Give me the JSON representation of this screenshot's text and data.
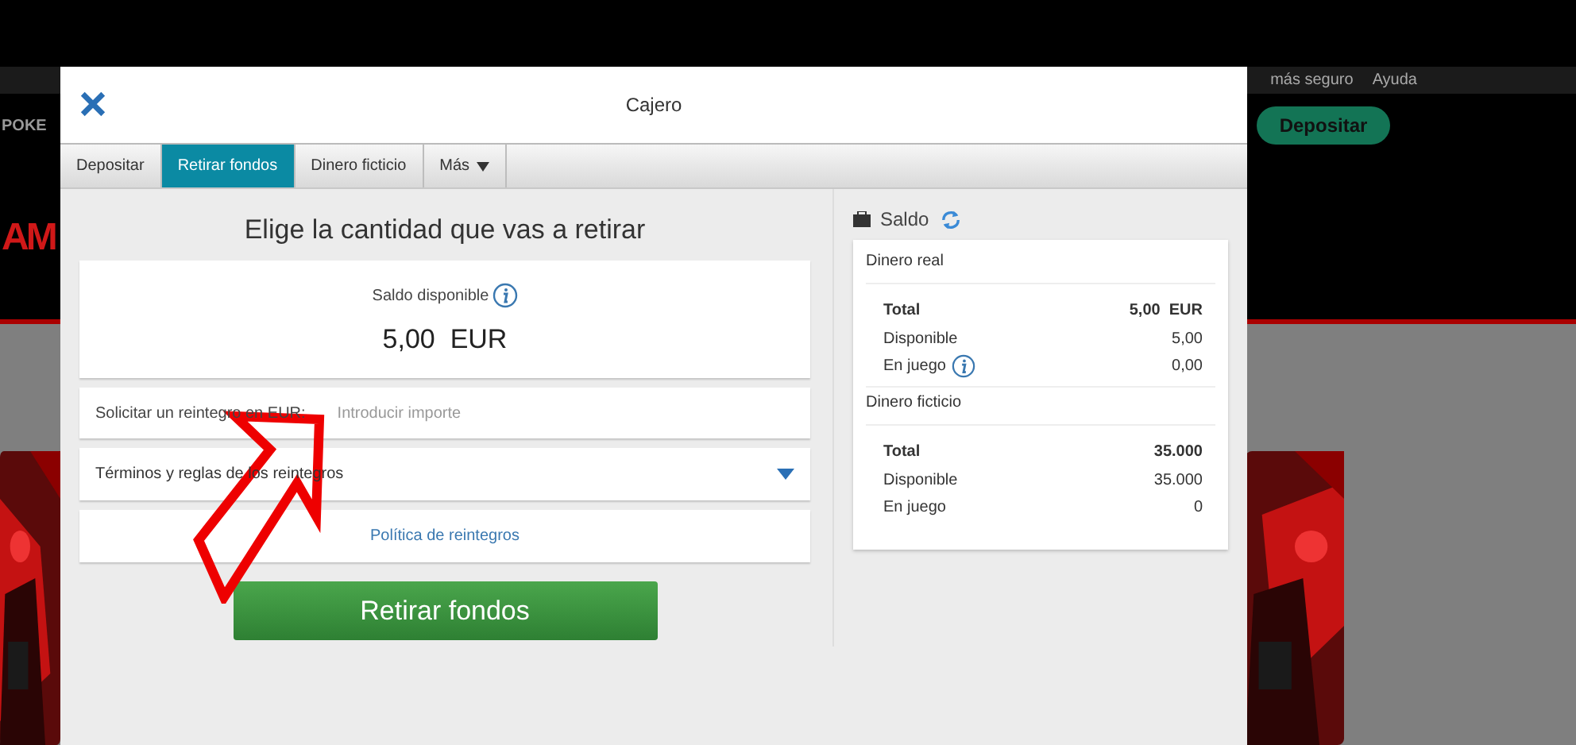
{
  "site": {
    "logo": "POKE",
    "nav_links": [
      "más seguro",
      "Ayuda"
    ],
    "deposit_button": "Depositar",
    "banner_text": "AM"
  },
  "window": {
    "title": "Cajero"
  },
  "tabs": [
    {
      "label": "Depositar",
      "selected": false,
      "dropdown": false
    },
    {
      "label": "Retirar fondos",
      "selected": true,
      "dropdown": false
    },
    {
      "label": "Dinero ficticio",
      "selected": false,
      "dropdown": false
    },
    {
      "label": "Más",
      "selected": false,
      "dropdown": true
    }
  ],
  "withdraw": {
    "heading": "Elige la cantidad que vas a retirar",
    "balance_label": "Saldo disponible",
    "balance_value": "5,00  EUR",
    "amount_label": "Solicitar un reintegro en EUR:",
    "amount_placeholder": "Introducir importe",
    "terms": {
      "label": "Términos y reglas de los reintegros",
      "expanded": false
    },
    "policy_link": "Política de reintegros",
    "submit_button": "Retirar fondos"
  },
  "balance": {
    "title": "Saldo",
    "sections": [
      {
        "title": "Dinero real",
        "rows": [
          {
            "label": "Total",
            "value": "5,00  EUR",
            "bold": true,
            "info": false
          },
          {
            "label": "Disponible",
            "value": "5,00",
            "bold": false,
            "info": false
          },
          {
            "label": "En juego",
            "value": "0,00",
            "bold": false,
            "info": true
          }
        ]
      },
      {
        "title": "Dinero ficticio",
        "rows": [
          {
            "label": "Total",
            "value": "35.000",
            "bold": true,
            "info": false
          },
          {
            "label": "Disponible",
            "value": "35.000",
            "bold": false,
            "info": false
          },
          {
            "label": "En juego",
            "value": "0",
            "bold": false,
            "info": false
          }
        ]
      }
    ]
  },
  "annotation": {
    "kind": "arrow"
  }
}
